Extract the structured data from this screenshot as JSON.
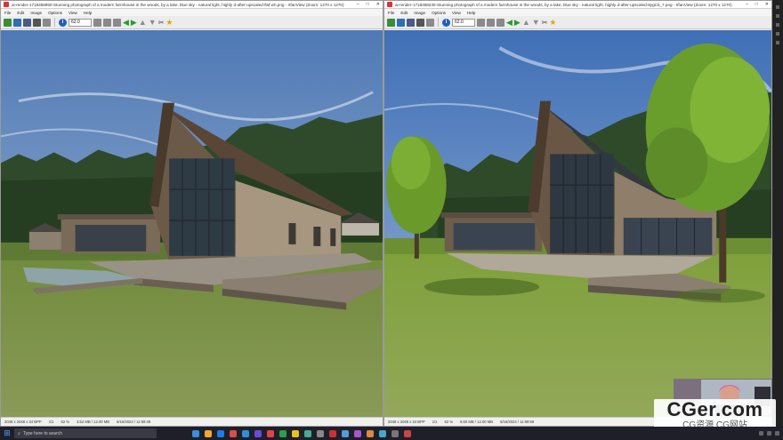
{
  "left_window": {
    "title": "ai-render-1718358950-Stunning photograph of a modern farmhouse in the woods, by a lake, blue sky - natural light, highly d-after-upscaled-flaf.wh.png - IrfanView (Zoom: 1270 x 1270)",
    "menu": [
      "File",
      "Edit",
      "Image",
      "Options",
      "View",
      "Help"
    ],
    "zoom": "62.0",
    "status": [
      "2048 x 2048 x 24 BPP",
      "1/1",
      "62 %",
      "3.52 MB / 12.00 MB",
      "6/16/2024 / 11:59:49"
    ]
  },
  "right_window": {
    "title": "ai-render-1718358230-Stunning photograph of a modern farmhouse in the woods, by a lake, blue sky - natural light, highly d-after-upscaled-8ygC5_7.png - IrfanView (Zoom: 1270 x 1270)",
    "menu": [
      "File",
      "Edit",
      "Image",
      "Options",
      "View",
      "Help"
    ],
    "zoom": "62.0",
    "status": [
      "2048 x 2048 x 24 BPP",
      "1/1",
      "62 %",
      "6.60 MB / 12.00 MB",
      "6/16/2024 / 11:59:59"
    ]
  },
  "watermark": {
    "main": "CGer.com",
    "sub": "CG资源 CG网站"
  },
  "taskbar": {
    "search_placeholder": "Type here to search"
  },
  "icons": {
    "open": "folder-icon",
    "save": "save-icon",
    "info": "info-icon",
    "prev": "arrow-left-icon",
    "next": "arrow-right-icon",
    "star": "star-icon"
  }
}
